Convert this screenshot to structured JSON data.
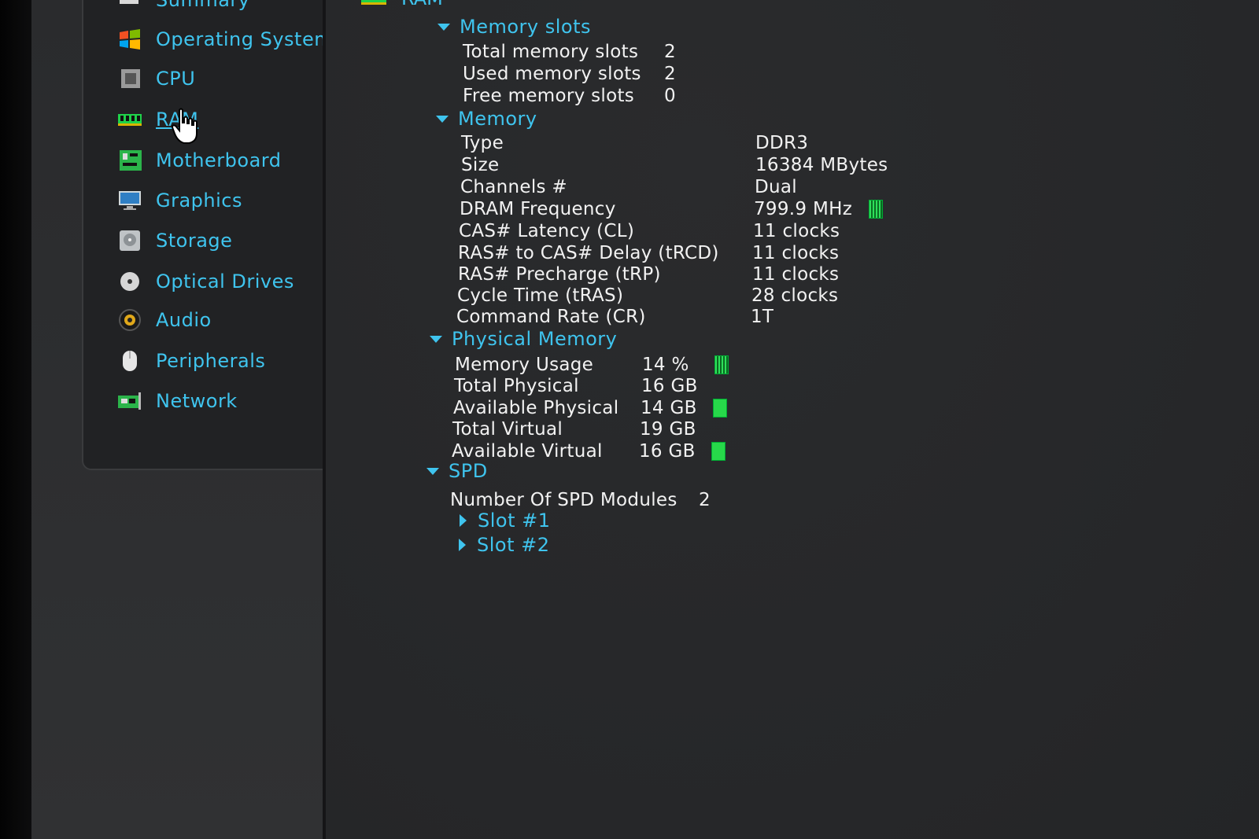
{
  "header": {
    "title": "RAM"
  },
  "sidebar": {
    "items": [
      {
        "label": "Summary",
        "icon": "summary-icon"
      },
      {
        "label": "Operating System",
        "icon": "windows-logo-icon"
      },
      {
        "label": "CPU",
        "icon": "cpu-chip-icon"
      },
      {
        "label": "RAM",
        "icon": "ram-module-icon",
        "active": true
      },
      {
        "label": "Motherboard",
        "icon": "motherboard-icon"
      },
      {
        "label": "Graphics",
        "icon": "monitor-icon"
      },
      {
        "label": "Storage",
        "icon": "hard-drive-icon"
      },
      {
        "label": "Optical Drives",
        "icon": "optical-disc-icon"
      },
      {
        "label": "Audio",
        "icon": "speaker-icon"
      },
      {
        "label": "Peripherals",
        "icon": "mouse-icon"
      },
      {
        "label": "Network",
        "icon": "network-card-icon"
      }
    ]
  },
  "memory_slots": {
    "title": "Memory slots",
    "rows": [
      {
        "label": "Total memory slots",
        "value": "2"
      },
      {
        "label": "Used memory slots",
        "value": "2"
      },
      {
        "label": "Free memory slots",
        "value": "0"
      }
    ]
  },
  "memory": {
    "title": "Memory",
    "rows": [
      {
        "label": "Type",
        "value": "DDR3"
      },
      {
        "label": "Size",
        "value": "16384 MBytes"
      },
      {
        "label": "Channels #",
        "value": "Dual"
      },
      {
        "label": "DRAM Frequency",
        "value": "799.9 MHz"
      },
      {
        "label": "CAS# Latency (CL)",
        "value": "11 clocks"
      },
      {
        "label": "RAS# to CAS# Delay (tRCD)",
        "value": "11 clocks"
      },
      {
        "label": "RAS# Precharge (tRP)",
        "value": "11 clocks"
      },
      {
        "label": "Cycle Time (tRAS)",
        "value": "28 clocks"
      },
      {
        "label": "Command Rate (CR)",
        "value": "1T"
      }
    ]
  },
  "physical_memory": {
    "title": "Physical Memory",
    "rows": [
      {
        "label": "Memory Usage",
        "value": "14 %"
      },
      {
        "label": "Total Physical",
        "value": "16 GB"
      },
      {
        "label": "Available Physical",
        "value": "14 GB"
      },
      {
        "label": "Total Virtual",
        "value": "19 GB"
      },
      {
        "label": "Available Virtual",
        "value": "16 GB"
      }
    ]
  },
  "spd": {
    "title": "SPD",
    "modules_label": "Number Of SPD Modules",
    "modules_value": "2",
    "slots": [
      "Slot #1",
      "Slot #2"
    ]
  },
  "colors": {
    "accent": "#3fc4ee",
    "text": "#f2f2f2",
    "indicator": "#27d84a"
  }
}
